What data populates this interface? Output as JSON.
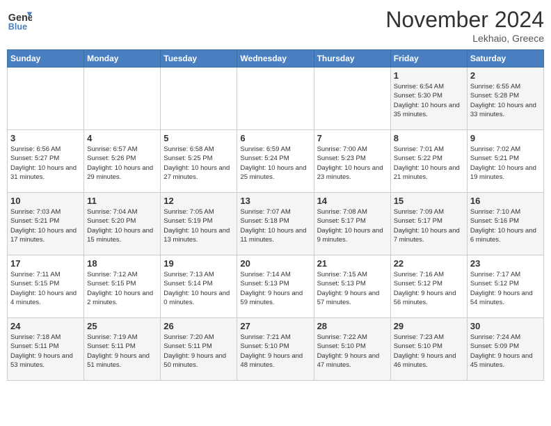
{
  "header": {
    "logo_line1": "General",
    "logo_line2": "Blue",
    "month": "November 2024",
    "location": "Lekhaio, Greece"
  },
  "weekdays": [
    "Sunday",
    "Monday",
    "Tuesday",
    "Wednesday",
    "Thursday",
    "Friday",
    "Saturday"
  ],
  "weeks": [
    [
      {
        "day": "",
        "info": ""
      },
      {
        "day": "",
        "info": ""
      },
      {
        "day": "",
        "info": ""
      },
      {
        "day": "",
        "info": ""
      },
      {
        "day": "",
        "info": ""
      },
      {
        "day": "1",
        "info": "Sunrise: 6:54 AM\nSunset: 5:30 PM\nDaylight: 10 hours\nand 35 minutes."
      },
      {
        "day": "2",
        "info": "Sunrise: 6:55 AM\nSunset: 5:28 PM\nDaylight: 10 hours\nand 33 minutes."
      }
    ],
    [
      {
        "day": "3",
        "info": "Sunrise: 6:56 AM\nSunset: 5:27 PM\nDaylight: 10 hours\nand 31 minutes."
      },
      {
        "day": "4",
        "info": "Sunrise: 6:57 AM\nSunset: 5:26 PM\nDaylight: 10 hours\nand 29 minutes."
      },
      {
        "day": "5",
        "info": "Sunrise: 6:58 AM\nSunset: 5:25 PM\nDaylight: 10 hours\nand 27 minutes."
      },
      {
        "day": "6",
        "info": "Sunrise: 6:59 AM\nSunset: 5:24 PM\nDaylight: 10 hours\nand 25 minutes."
      },
      {
        "day": "7",
        "info": "Sunrise: 7:00 AM\nSunset: 5:23 PM\nDaylight: 10 hours\nand 23 minutes."
      },
      {
        "day": "8",
        "info": "Sunrise: 7:01 AM\nSunset: 5:22 PM\nDaylight: 10 hours\nand 21 minutes."
      },
      {
        "day": "9",
        "info": "Sunrise: 7:02 AM\nSunset: 5:21 PM\nDaylight: 10 hours\nand 19 minutes."
      }
    ],
    [
      {
        "day": "10",
        "info": "Sunrise: 7:03 AM\nSunset: 5:21 PM\nDaylight: 10 hours\nand 17 minutes."
      },
      {
        "day": "11",
        "info": "Sunrise: 7:04 AM\nSunset: 5:20 PM\nDaylight: 10 hours\nand 15 minutes."
      },
      {
        "day": "12",
        "info": "Sunrise: 7:05 AM\nSunset: 5:19 PM\nDaylight: 10 hours\nand 13 minutes."
      },
      {
        "day": "13",
        "info": "Sunrise: 7:07 AM\nSunset: 5:18 PM\nDaylight: 10 hours\nand 11 minutes."
      },
      {
        "day": "14",
        "info": "Sunrise: 7:08 AM\nSunset: 5:17 PM\nDaylight: 10 hours\nand 9 minutes."
      },
      {
        "day": "15",
        "info": "Sunrise: 7:09 AM\nSunset: 5:17 PM\nDaylight: 10 hours\nand 7 minutes."
      },
      {
        "day": "16",
        "info": "Sunrise: 7:10 AM\nSunset: 5:16 PM\nDaylight: 10 hours\nand 6 minutes."
      }
    ],
    [
      {
        "day": "17",
        "info": "Sunrise: 7:11 AM\nSunset: 5:15 PM\nDaylight: 10 hours\nand 4 minutes."
      },
      {
        "day": "18",
        "info": "Sunrise: 7:12 AM\nSunset: 5:15 PM\nDaylight: 10 hours\nand 2 minutes."
      },
      {
        "day": "19",
        "info": "Sunrise: 7:13 AM\nSunset: 5:14 PM\nDaylight: 10 hours\nand 0 minutes."
      },
      {
        "day": "20",
        "info": "Sunrise: 7:14 AM\nSunset: 5:13 PM\nDaylight: 9 hours\nand 59 minutes."
      },
      {
        "day": "21",
        "info": "Sunrise: 7:15 AM\nSunset: 5:13 PM\nDaylight: 9 hours\nand 57 minutes."
      },
      {
        "day": "22",
        "info": "Sunrise: 7:16 AM\nSunset: 5:12 PM\nDaylight: 9 hours\nand 56 minutes."
      },
      {
        "day": "23",
        "info": "Sunrise: 7:17 AM\nSunset: 5:12 PM\nDaylight: 9 hours\nand 54 minutes."
      }
    ],
    [
      {
        "day": "24",
        "info": "Sunrise: 7:18 AM\nSunset: 5:11 PM\nDaylight: 9 hours\nand 53 minutes."
      },
      {
        "day": "25",
        "info": "Sunrise: 7:19 AM\nSunset: 5:11 PM\nDaylight: 9 hours\nand 51 minutes."
      },
      {
        "day": "26",
        "info": "Sunrise: 7:20 AM\nSunset: 5:11 PM\nDaylight: 9 hours\nand 50 minutes."
      },
      {
        "day": "27",
        "info": "Sunrise: 7:21 AM\nSunset: 5:10 PM\nDaylight: 9 hours\nand 48 minutes."
      },
      {
        "day": "28",
        "info": "Sunrise: 7:22 AM\nSunset: 5:10 PM\nDaylight: 9 hours\nand 47 minutes."
      },
      {
        "day": "29",
        "info": "Sunrise: 7:23 AM\nSunset: 5:10 PM\nDaylight: 9 hours\nand 46 minutes."
      },
      {
        "day": "30",
        "info": "Sunrise: 7:24 AM\nSunset: 5:09 PM\nDaylight: 9 hours\nand 45 minutes."
      }
    ]
  ]
}
